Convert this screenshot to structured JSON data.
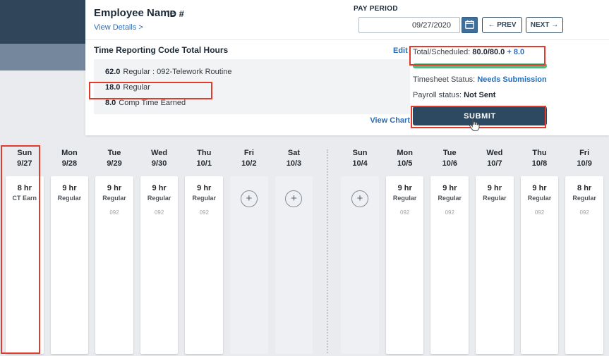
{
  "header": {
    "employee_name": "Employee Name",
    "employee_id": "ID #",
    "view_details": "View Details >"
  },
  "pay_period": {
    "label": "PAY PERIOD",
    "date": "09/27/2020",
    "prev": "← PREV",
    "next": "NEXT →"
  },
  "totals": {
    "title": "Time Reporting Code Total Hours",
    "edit": "Edit",
    "view_chart": "View Chart",
    "rows": [
      {
        "hours": "62.0",
        "label": "Regular : 092-Telework Routine"
      },
      {
        "hours": "18.0",
        "label": "Regular"
      },
      {
        "hours": "8.0",
        "label": "Comp Time Earned",
        "highlighted": true
      }
    ]
  },
  "summary": {
    "total_label": "Total/Scheduled:",
    "total_value": "80.0/80.0",
    "extra_value": "+ 8.0",
    "progress_percent": 100,
    "progress_color": "#58b783",
    "timesheet_status_label": "Timesheet Status:",
    "timesheet_status_value": "Needs Submission",
    "payroll_status_label": "Payroll status:",
    "payroll_status_value": "Not Sent",
    "submit": "SUBMIT"
  },
  "calendar": {
    "add_label": "+",
    "days": [
      {
        "day": "Sun",
        "date": "9/27",
        "hours": "8 hr",
        "type": "CT Earn",
        "code": "",
        "highlighted": true
      },
      {
        "day": "Mon",
        "date": "9/28",
        "hours": "9 hr",
        "type": "Regular",
        "code": ""
      },
      {
        "day": "Tue",
        "date": "9/29",
        "hours": "9 hr",
        "type": "Regular",
        "code": "092"
      },
      {
        "day": "Wed",
        "date": "9/30",
        "hours": "9 hr",
        "type": "Regular",
        "code": "092"
      },
      {
        "day": "Thu",
        "date": "10/1",
        "hours": "9 hr",
        "type": "Regular",
        "code": "092"
      },
      {
        "day": "Fri",
        "date": "10/2",
        "empty": true
      },
      {
        "day": "Sat",
        "date": "10/3",
        "empty": true
      },
      {
        "day": "Sun",
        "date": "10/4",
        "empty": true,
        "new_week": true
      },
      {
        "day": "Mon",
        "date": "10/5",
        "hours": "9 hr",
        "type": "Regular",
        "code": "092"
      },
      {
        "day": "Tue",
        "date": "10/6",
        "hours": "9 hr",
        "type": "Regular",
        "code": "092"
      },
      {
        "day": "Wed",
        "date": "10/7",
        "hours": "9 hr",
        "type": "Regular",
        "code": ""
      },
      {
        "day": "Thu",
        "date": "10/8",
        "hours": "9 hr",
        "type": "Regular",
        "code": "092"
      },
      {
        "day": "Fri",
        "date": "10/9",
        "hours": "8 hr",
        "type": "Regular",
        "code": "092"
      }
    ]
  },
  "annotation_color": "#e23a2c"
}
